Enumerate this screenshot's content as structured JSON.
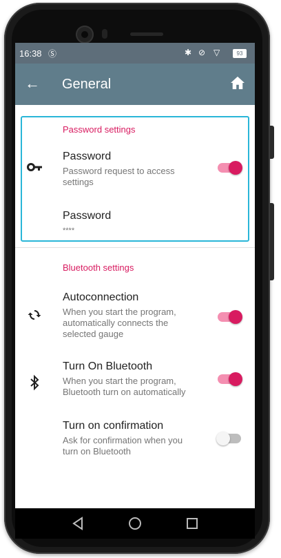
{
  "status_bar": {
    "time": "16:38",
    "battery": "93"
  },
  "toolbar": {
    "title": "General"
  },
  "password_section": {
    "header": "Password settings",
    "items": [
      {
        "title": "Password",
        "subtitle": "Password request to access settings",
        "icon": "key-icon",
        "switch_on": true
      },
      {
        "title": "Password",
        "subtitle": "****"
      }
    ]
  },
  "bluetooth_section": {
    "header": "Bluetooth settings",
    "items": [
      {
        "title": "Autoconnection",
        "subtitle": "When you start the program, automatically connects the selected gauge",
        "icon": "sync-icon",
        "switch_on": true
      },
      {
        "title": "Turn On Bluetooth",
        "subtitle": "When you start the program, Bluetooth turn on automatically",
        "icon": "bluetooth-icon",
        "switch_on": true
      },
      {
        "title": "Turn on confirmation",
        "subtitle": "Ask for confirmation when you turn on Bluetooth",
        "switch_on": false
      }
    ]
  },
  "colors": {
    "accent": "#d81b60",
    "toolbar": "#607d8b",
    "highlight": "#29b6d8"
  }
}
